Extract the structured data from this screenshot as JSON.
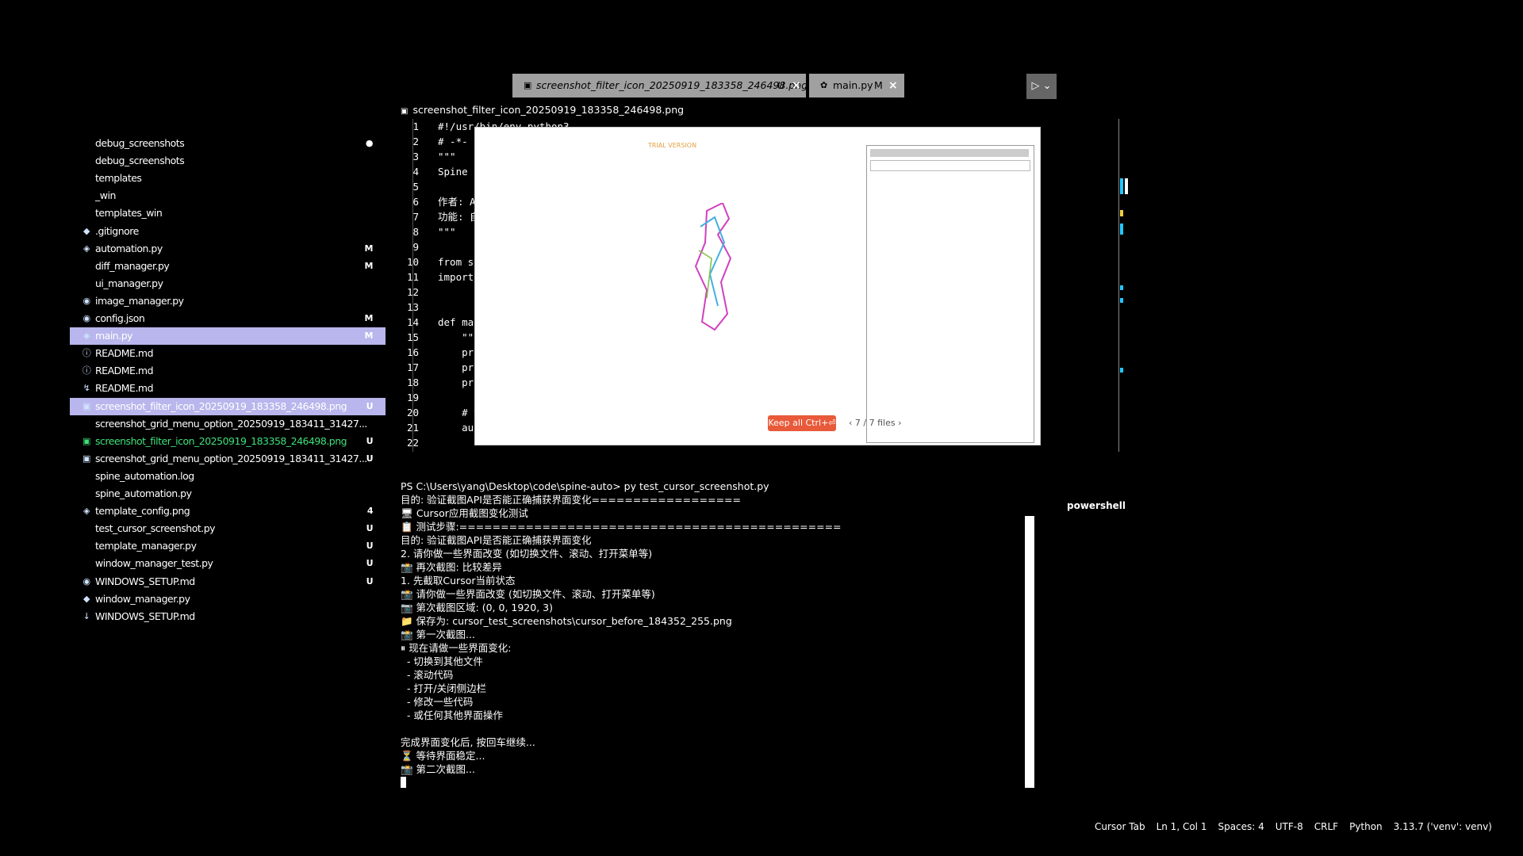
{
  "tabs": [
    {
      "icon": "image-icon",
      "label": "screenshot_filter_icon_20250919_183358_246498.png",
      "badge": "U",
      "close": "×"
    },
    {
      "icon": "python-icon",
      "label": "main.py",
      "badge": "M",
      "close": "×"
    }
  ],
  "run_button": "▷ ⌄",
  "breadcrumb": "screenshot_filter_icon_20250919_183358_246498.png",
  "sidebar": {
    "items": [
      {
        "label": "debug_screenshots",
        "badge": "●",
        "icon": ""
      },
      {
        "label": "debug_screenshots",
        "badge": "",
        "icon": ""
      },
      {
        "label": "templates",
        "badge": "",
        "icon": ""
      },
      {
        "label": "_win",
        "badge": "",
        "icon": ""
      },
      {
        "label": "templates_win",
        "badge": "",
        "icon": ""
      },
      {
        "label": ".gitignore",
        "badge": "",
        "icon": "◆"
      },
      {
        "label": "automation.py",
        "badge": "M",
        "icon": "◈"
      },
      {
        "label": "diff_manager.py",
        "badge": "M",
        "icon": ""
      },
      {
        "label": "ui_manager.py",
        "badge": "",
        "icon": ""
      },
      {
        "label": "image_manager.py",
        "badge": "",
        "icon": "◉"
      },
      {
        "label": "config.json",
        "badge": "M",
        "icon": "◉"
      },
      {
        "label": "main.py",
        "badge": "M",
        "icon": "◈"
      },
      {
        "label": "README.md",
        "badge": "",
        "icon": "ⓘ"
      },
      {
        "label": "README.md",
        "badge": "",
        "icon": "ⓘ"
      },
      {
        "label": "README.md",
        "badge": "",
        "icon": "↯"
      },
      {
        "label": "screenshot_filter_icon_20250919_183358_246498.png",
        "badge": "U",
        "icon": "▣"
      },
      {
        "label": "screenshot_grid_menu_option_20250919_183411_31427...",
        "badge": "",
        "icon": ""
      },
      {
        "label": "screenshot_filter_icon_20250919_183358_246498.png",
        "badge": "U",
        "icon": "▣"
      },
      {
        "label": "screenshot_grid_menu_option_20250919_183411_31427...",
        "badge": "U",
        "icon": "▣"
      },
      {
        "label": "spine_automation.log",
        "badge": "",
        "icon": ""
      },
      {
        "label": "spine_automation.py",
        "badge": "",
        "icon": ""
      },
      {
        "label": "template_config.png",
        "badge": "4",
        "icon": "◈"
      },
      {
        "label": "test_cursor_screenshot.py",
        "badge": "U",
        "icon": ""
      },
      {
        "label": "template_manager.py",
        "badge": "U",
        "icon": ""
      },
      {
        "label": "window_manager_test.py",
        "badge": "U",
        "icon": ""
      },
      {
        "label": "WINDOWS_SETUP.md",
        "badge": "U",
        "icon": "◉"
      },
      {
        "label": "window_manager.py",
        "badge": "",
        "icon": "◆"
      },
      {
        "label": "WINDOWS_SETUP.md",
        "badge": "",
        "icon": "↓"
      }
    ],
    "selected_index": 11,
    "highlighted_index": 15,
    "green_index": 17
  },
  "editor": {
    "lines": [
      {
        "n": "1",
        "code": "#!/usr/bin/env python3"
      },
      {
        "n": "2",
        "code": "# -*- coding: utf-8 -*-"
      },
      {
        "n": "3",
        "code": "\"\"\""
      },
      {
        "n": "4",
        "code": "Spine 自动化脚本 - 主入口文件"
      },
      {
        "n": "5",
        "code": ""
      },
      {
        "n": "6",
        "code": "作者: Assistant"
      },
      {
        "n": "7",
        "code": "功能: 自动化操作Spine软件"
      },
      {
        "n": "8",
        "code": "\"\"\""
      },
      {
        "n": "9",
        "code": ""
      },
      {
        "n": "10",
        "code": "from spine_automation import SpineAutomation"
      },
      {
        "n": "11",
        "code": "import pyautogui"
      },
      {
        "n": "12",
        "code": ""
      },
      {
        "n": "13",
        "code": ""
      },
      {
        "n": "14",
        "code": "def main():"
      },
      {
        "n": "15",
        "code": "    \"\"\"主函数\"\"\""
      },
      {
        "n": "16",
        "code": "    print(\"=== Spine 自动化脚本 ===\")"
      },
      {
        "n": "17",
        "code": "    print(\"功能: 自动打开Spine软件并加载项目\")"
      },
      {
        "n": "18",
        "code": "    print()"
      },
      {
        "n": "19",
        "code": ""
      },
      {
        "n": "20",
        "code": "    # 创建自动化实例"
      },
      {
        "n": "21",
        "code": "    automation = SpineAutomation()"
      },
      {
        "n": "22",
        "code": ""
      }
    ]
  },
  "preview": {
    "trial_text": "TRIAL VERSION",
    "keep_all": "Keep all Ctrl+⏎",
    "pager": "‹ 7 / 7 files ›"
  },
  "terminal": {
    "label": "powershell",
    "lines": [
      "PS C:\\Users\\yang\\Desktop\\code\\spine-auto> py test_cursor_screenshot.py",
      "目的: 验证截图API是否能正确捕获界面变化==================",
      "🖥 Cursor应用截图变化测试",
      "📋 测试步骤:==============================================",
      "目的: 验证截图API是否能正确捕获界面变化",
      "2. 请你做一些界面改变 (如切换文件、滚动、打开菜单等)",
      "📸 再次截图: 比较差异",
      "1. 先截取Cursor当前状态",
      "📸 请你做一些界面改变 (如切换文件、滚动、打开菜单等)",
      "📷 第次截图区域: (0, 0, 1920, 3)",
      "📁 保存为: cursor_test_screenshots\\cursor_before_184352_255.png",
      "📸 第一次截图...",
      "⏸ 现在请做一些界面变化:",
      "  - 切换到其他文件",
      "  - 滚动代码",
      "  - 打开/关闭侧边栏",
      "  - 修改一些代码",
      "  - 或任何其他界面操作",
      "",
      "完成界面变化后, 按回车继续...",
      "⏳ 等待界面稳定...",
      "📸 第二次截图..."
    ]
  },
  "statusbar": {
    "items": [
      "Cursor Tab",
      "Ln 1, Col 1",
      "Spaces: 4",
      "UTF-8",
      "CRLF",
      "Python",
      "3.13.7 ('venv': venv)"
    ]
  },
  "colors": {
    "selected_bg": "#b8b6ec",
    "green": "#3fe07a",
    "tab_bg": "#a0a0a0",
    "keep_all_bg": "#e85a3a"
  }
}
